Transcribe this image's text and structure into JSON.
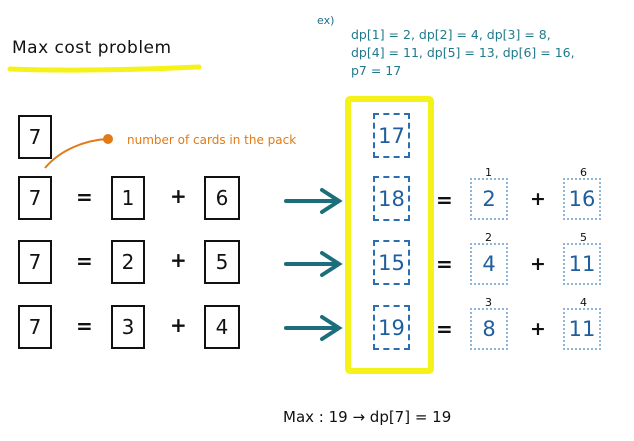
{
  "title": "Max cost problem",
  "example": {
    "label": "ex)",
    "lines": [
      "dp[1]  = 2, dp[2] = 4, dp[3] = 8,",
      "dp[4] = 11, dp[5] = 13, dp[6] = 16,",
      "p7 = 17"
    ]
  },
  "total_card": "7",
  "annotation": "number of cards in the pack",
  "rows": [
    {
      "n": "7",
      "eq": "=",
      "a": "1",
      "plus": "+",
      "b": "6",
      "sum": "18",
      "eq2": "=",
      "va": "2",
      "plus2": "+",
      "vb": "16",
      "ia": "1",
      "ib": "6"
    },
    {
      "n": "7",
      "eq": "=",
      "a": "2",
      "plus": "+",
      "b": "5",
      "sum": "15",
      "eq2": "=",
      "va": "4",
      "plus2": "+",
      "vb": "11",
      "ia": "2",
      "ib": "5"
    },
    {
      "n": "7",
      "eq": "=",
      "a": "3",
      "plus": "+",
      "b": "4",
      "sum": "19",
      "eq2": "=",
      "va": "8",
      "plus2": "+",
      "vb": "11",
      "ia": "3",
      "ib": "4"
    }
  ],
  "direct_value": "17",
  "footer": "Max : 19 → dp[7] = 19",
  "colors": {
    "highlight": "#f5f21a",
    "arrow": "#1c6f7a",
    "annotation": "#e07b15",
    "dp_box": "#2c6fb0",
    "dotted_box": "#8fb6d8"
  }
}
